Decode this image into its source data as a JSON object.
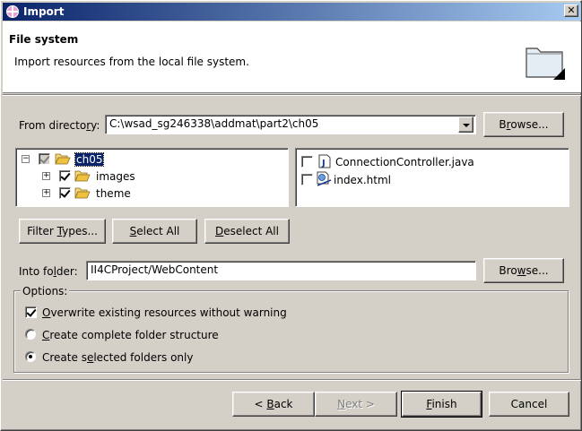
{
  "window": {
    "title": "Import"
  },
  "banner": {
    "title": "File system",
    "description": "Import resources from the local file system."
  },
  "from_directory": {
    "label_pre": "From directo",
    "label_acc": "r",
    "label_post": "y:",
    "value": "C:\\wsad_sg246338\\addmat\\part2\\ch05",
    "browse_pre": "B",
    "browse_acc": "r",
    "browse_post": "owse..."
  },
  "folder_tree": [
    {
      "label": "ch05",
      "icon": "folder-open-icon",
      "checked": "grey",
      "selected": true,
      "expander": "minus"
    },
    {
      "label": "images",
      "icon": "folder-open-icon",
      "checked": "checked",
      "selected": false,
      "expander": "plus"
    },
    {
      "label": "theme",
      "icon": "folder-open-icon",
      "checked": "checked",
      "selected": false,
      "expander": "plus"
    }
  ],
  "file_list": [
    {
      "label": "ConnectionController.java",
      "icon": "java-file-icon",
      "checked": false
    },
    {
      "label": "index.html",
      "icon": "html-file-icon",
      "checked": false
    }
  ],
  "selection_buttons": {
    "filter_pre": "Filter ",
    "filter_acc": "T",
    "filter_post": "ypes...",
    "select_all_acc": "S",
    "select_all_post": "elect All",
    "deselect_all_acc": "D",
    "deselect_all_post": "eselect All"
  },
  "into_folder": {
    "label_pre": "Into fo",
    "label_acc": "l",
    "label_post": "der:",
    "value": "II4CProject/WebContent",
    "browse_pre": "Bro",
    "browse_acc": "w",
    "browse_post": "se..."
  },
  "options": {
    "title": "Options:",
    "overwrite": {
      "acc": "O",
      "post": "verwrite existing resources without warning",
      "checked": true
    },
    "complete_structure": {
      "acc": "C",
      "post": "reate complete folder structure",
      "selected": false
    },
    "selected_only": {
      "pre": "Create s",
      "acc": "e",
      "post": "lected folders only",
      "selected": true
    }
  },
  "footer": {
    "back_pre": "< ",
    "back_acc": "B",
    "back_post": "ack",
    "next_acc": "N",
    "next_post": "ext >",
    "finish_acc": "F",
    "finish_post": "inish",
    "cancel": "Cancel"
  },
  "colors": {
    "titlebar_start": "#0a246a",
    "titlebar_end": "#a6caf0",
    "dialog_bg": "#d4d0c8",
    "selection": "#0a246a"
  }
}
